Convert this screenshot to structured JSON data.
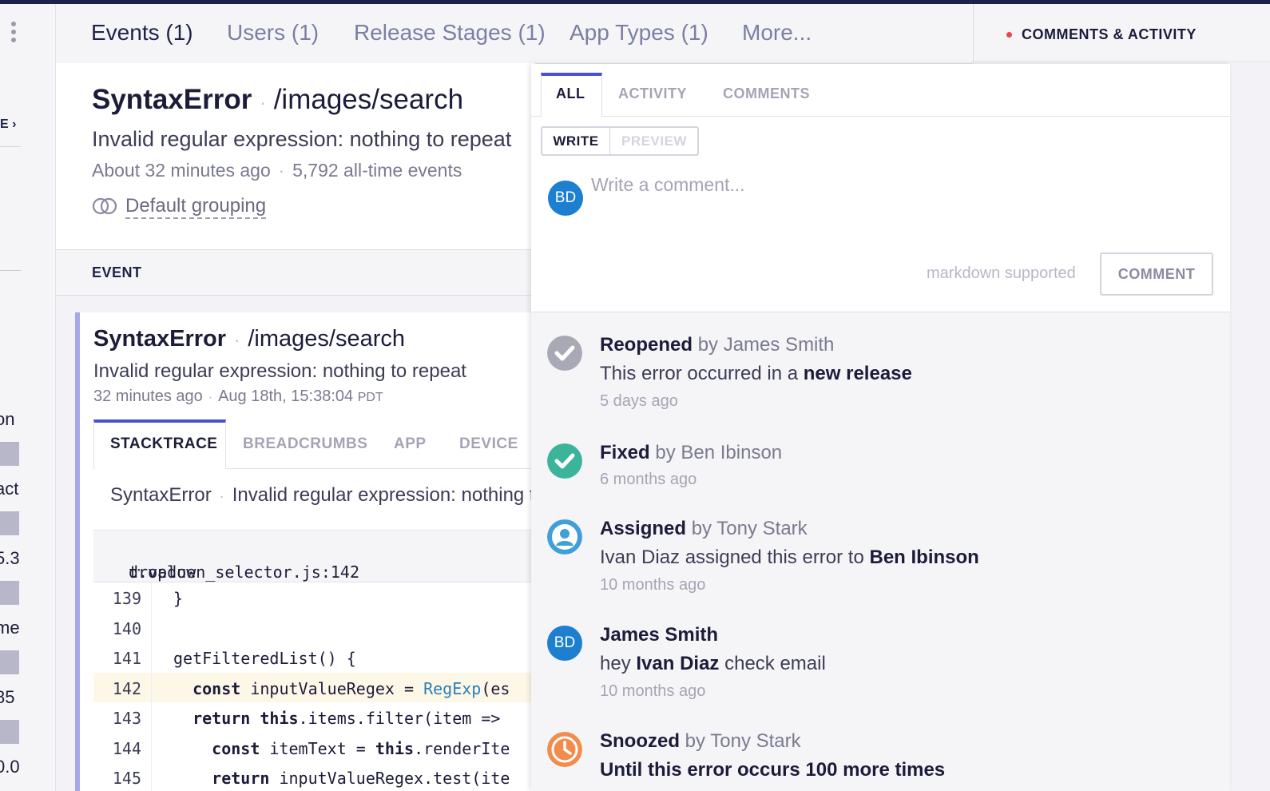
{
  "left_panel": {
    "crumb": "E ›",
    "stats": [
      "on",
      "act",
      "5.3",
      "me",
      "85",
      "0.0"
    ]
  },
  "nav": {
    "tabs": [
      "Events (1)",
      "Users (1)",
      "Release Stages (1)",
      "App Types (1)",
      "More..."
    ],
    "comments_label": "COMMENTS & ACTIVITY"
  },
  "error": {
    "class": "SyntaxError",
    "context": "/images/search",
    "message": "Invalid regular expression: nothing to repeat",
    "time": "About 32 minutes ago",
    "events": "5,792 all-time events",
    "grouping": "Default grouping"
  },
  "event_section_label": "EVENT",
  "event": {
    "class": "SyntaxError",
    "context": "/images/search",
    "message": "Invalid regular expression: nothing to repeat",
    "relative_time": "32 minutes ago",
    "timestamp": "Aug 18th, 15:38:04",
    "tz": "PDT",
    "tabs": [
      "STACKTRACE",
      "BREADCRUMBS",
      "APP",
      "DEVICE"
    ],
    "summary_class": "SyntaxError",
    "summary_message": "Invalid regular expression: nothing t",
    "file": "dropdown_selector.js:142",
    "method": "t.value"
  },
  "code": [
    {
      "ln": "139",
      "src": "}"
    },
    {
      "ln": "140",
      "src": ""
    },
    {
      "ln": "141",
      "src": "getFilteredList() {"
    },
    {
      "ln": "142",
      "src": "  const inputValueRegex = RegExp(es",
      "hl": true
    },
    {
      "ln": "143",
      "src": "  return this.items.filter(item =>"
    },
    {
      "ln": "144",
      "src": "    const itemText = this.renderIte"
    },
    {
      "ln": "145",
      "src": "    return inputValueRegex.test(ite"
    }
  ],
  "panel": {
    "tabs": [
      "ALL",
      "ACTIVITY",
      "COMMENTS"
    ],
    "write": "WRITE",
    "preview": "PREVIEW",
    "avatar_initials": "BD",
    "comment_placeholder": "Write a comment...",
    "markdown_note": "markdown supported",
    "comment_button": "COMMENT"
  },
  "activity": [
    {
      "icon": "reopened-icon",
      "color": "#a9a9b6",
      "action": "Reopened",
      "by": "by James Smith",
      "detail_pre": "This error occurred in a ",
      "detail_bold": "new release",
      "detail_post": "",
      "time": "5 days ago"
    },
    {
      "icon": "fixed-icon",
      "color": "#3bb49a",
      "action": "Fixed",
      "by": "by Ben Ibinson",
      "detail_pre": "",
      "detail_bold": "",
      "detail_post": "",
      "time": "6 months ago"
    },
    {
      "icon": "assigned-icon",
      "color": "#3f9fd9",
      "action": "Assigned",
      "by": "by Tony Stark",
      "detail_pre": "Ivan Diaz assigned this error to ",
      "detail_bold": "Ben Ibinson",
      "detail_post": "",
      "time": "10 months ago"
    },
    {
      "icon": "avatar",
      "color": "#1d7fd0",
      "initials": "BD",
      "action": "James Smith",
      "by": "",
      "detail_pre": "hey ",
      "detail_bold": "Ivan Diaz",
      "detail_post": " check email",
      "time": "10 months ago"
    },
    {
      "icon": "snoozed-icon",
      "color": "#f28c4c",
      "action": "Snoozed",
      "by": "by Tony Stark",
      "detail_pre": "",
      "detail_bold": "Until this error occurs 100 more times",
      "detail_post": "",
      "time": ""
    }
  ]
}
